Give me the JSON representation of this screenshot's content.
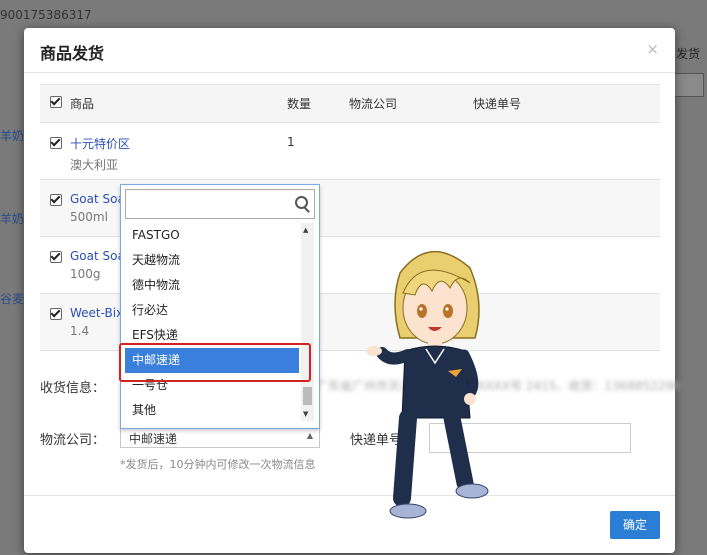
{
  "background": {
    "order_no": "900175386317",
    "left_links": [
      "羊奶",
      "羊奶",
      "谷麦"
    ],
    "right_text": "发货"
  },
  "modal": {
    "title": "商品发货",
    "close_label": "×",
    "table": {
      "headers": [
        "商品",
        "数量",
        "物流公司",
        "快递单号"
      ],
      "rows": [
        {
          "name": "十元特价区",
          "spec": "澳大利亚",
          "qty": "1"
        },
        {
          "name": "Goat Soap",
          "spec": "500ml",
          "qty": ""
        },
        {
          "name": "Goat Soap",
          "spec": "100g",
          "qty": ""
        },
        {
          "name": "Weet-Bix",
          "spec": "1.4",
          "qty": ""
        }
      ]
    },
    "receiver_label": "收货信息：",
    "receiver_value": "广东省广州市天河区XXXXX路XXXX号 2415，收货：1368852296",
    "shipping_label": "物流公司：",
    "shipping_value": "中邮速递",
    "tracking_label": "快递单号：",
    "tracking_value": "",
    "hint": "*发货后，10分钟内可修改一次物流信息",
    "ok_label": "确定"
  },
  "dropdown": {
    "search_placeholder": "",
    "items": [
      "FASTGO",
      "天越物流",
      "德中物流",
      "行必达",
      "EFS快递",
      "中邮速递",
      "一号仓",
      "其他"
    ],
    "selected_index": 5,
    "accent": "#3b7fdc",
    "highlight_color": "#d42222"
  }
}
